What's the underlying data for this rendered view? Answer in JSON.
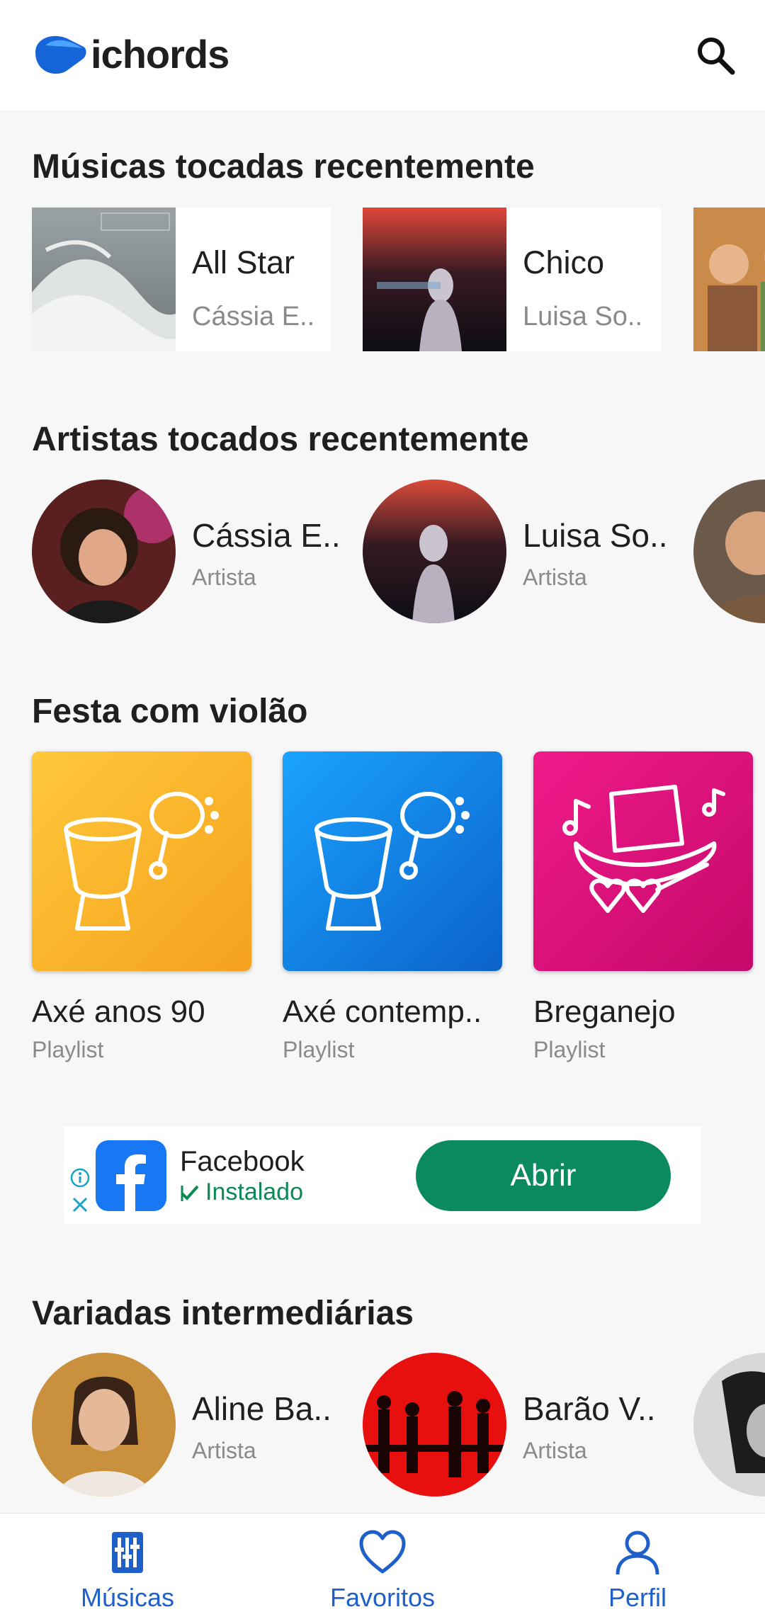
{
  "app": {
    "brand": "ichords"
  },
  "sections": {
    "recent_songs": {
      "title": "Músicas tocadas recentemente",
      "items": [
        {
          "title": "All Star",
          "artist": "Cássia E.."
        },
        {
          "title": "Chico",
          "artist": "Luisa So.."
        }
      ]
    },
    "recent_artists": {
      "title": "Artistas tocados recentemente",
      "items": [
        {
          "name": "Cássia E..",
          "role": "Artista"
        },
        {
          "name": "Luisa So..",
          "role": "Artista"
        }
      ]
    },
    "festa": {
      "title": "Festa com violão",
      "items": [
        {
          "name": "Axé anos 90",
          "type": "Playlist"
        },
        {
          "name": "Axé contemp..",
          "type": "Playlist"
        },
        {
          "name": "Breganejo",
          "type": "Playlist"
        }
      ]
    },
    "variadas": {
      "title": "Variadas intermediárias",
      "items": [
        {
          "name": "Aline Ba..",
          "role": "Artista"
        },
        {
          "name": "Barão V..",
          "role": "Artista"
        }
      ]
    }
  },
  "ad": {
    "app_name": "Facebook",
    "status": "Instalado",
    "button": "Abrir"
  },
  "bottom_nav": {
    "items": [
      {
        "label": "Músicas"
      },
      {
        "label": "Favoritos"
      },
      {
        "label": "Perfil"
      }
    ]
  },
  "colors": {
    "accent": "#1e5fc9",
    "ad_button": "#0b8a5f",
    "facebook": "#1877f2"
  }
}
